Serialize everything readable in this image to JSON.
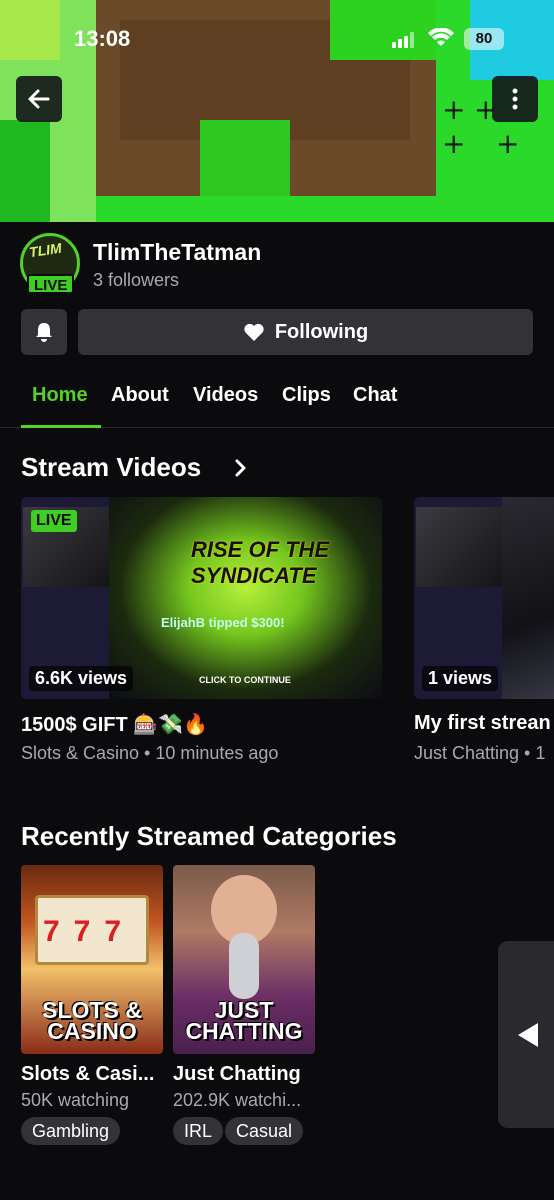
{
  "status_bar": {
    "time": "13:08",
    "battery": "80"
  },
  "channel": {
    "name": "TlimTheTatman",
    "followers": "3 followers",
    "live_label": "LIVE"
  },
  "actions": {
    "following_label": "Following"
  },
  "tabs": [
    {
      "label": "Home",
      "active": true
    },
    {
      "label": "About"
    },
    {
      "label": "Videos"
    },
    {
      "label": "Clips"
    },
    {
      "label": "Chat"
    }
  ],
  "stream_videos": {
    "title": "Stream Videos",
    "items": [
      {
        "live_label": "LIVE",
        "views": "6.6K views",
        "title": "1500$ GIFT 🎰💸🔥",
        "meta": "Slots & Casino • 10 minutes ago",
        "thumb_game_title": "RISE OF THE SYNDICATE",
        "thumb_tip": "ElijahB tipped $300!",
        "thumb_continue": "CLICK TO CONTINUE"
      },
      {
        "views": "1 views",
        "title": "My first strean",
        "meta": "Just Chatting • 1"
      }
    ]
  },
  "categories": {
    "title": "Recently Streamed Categories",
    "items": [
      {
        "art_label_1": "SLOTS &",
        "art_label_2": "CASINO",
        "name": "Slots & Casi...",
        "watching": "50K watching",
        "tags": [
          "Gambling"
        ]
      },
      {
        "art_label_1": "JUST",
        "art_label_2": "CHATTING",
        "name": "Just Chatting",
        "watching": "202.9K watchi...",
        "tags": [
          "IRL",
          "Casual"
        ]
      }
    ]
  },
  "colors": {
    "accent": "#53d12a",
    "background": "#0b0b0d",
    "surface": "#323237",
    "muted_text": "#a8a8ae"
  },
  "icons": [
    "back-arrow-icon",
    "more-vertical-icon",
    "bell-icon",
    "heart-icon",
    "chevron-right-icon",
    "play-left-icon"
  ]
}
